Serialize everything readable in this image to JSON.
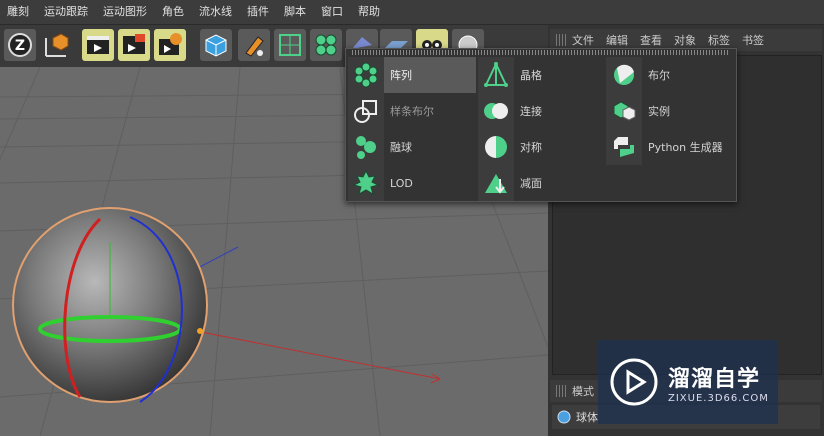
{
  "menubar": {
    "items": [
      "雕刻",
      "运动跟踪",
      "运动图形",
      "角色",
      "流水线",
      "插件",
      "脚本",
      "窗口",
      "帮助"
    ]
  },
  "toolbar": {
    "buttons": [
      {
        "icon": "z-snap-icon"
      },
      {
        "icon": "axis-cube-icon"
      },
      {
        "icon": "render-view-icon"
      },
      {
        "icon": "render-picture-icon"
      },
      {
        "icon": "render-settings-icon"
      },
      {
        "icon": "cube-icon"
      },
      {
        "icon": "pen-spline-icon"
      },
      {
        "icon": "subdivision-icon"
      },
      {
        "icon": "cloner-icon"
      },
      {
        "icon": "deformer-icon"
      },
      {
        "icon": "floor-icon"
      },
      {
        "icon": "camera-icon"
      },
      {
        "icon": "light-icon"
      }
    ]
  },
  "dropdown": {
    "columns": [
      [
        {
          "label": "阵列",
          "icon": "array-icon",
          "selected": true
        },
        {
          "label": "样条布尔",
          "icon": "spline-boole-icon",
          "dim": true
        },
        {
          "label": "融球",
          "icon": "metaball-icon"
        },
        {
          "label": "LOD",
          "icon": "lod-icon"
        }
      ],
      [
        {
          "label": "晶格",
          "icon": "atom-array-icon"
        },
        {
          "label": "连接",
          "icon": "connect-icon"
        },
        {
          "label": "对称",
          "icon": "symmetry-icon"
        },
        {
          "label": "减面",
          "icon": "polygon-reduction-icon"
        }
      ],
      [
        {
          "label": "布尔",
          "icon": "boole-icon"
        },
        {
          "label": "实例",
          "icon": "instance-icon"
        },
        {
          "label": "Python 生成器",
          "icon": "python-generator-icon"
        }
      ]
    ]
  },
  "right_panel": {
    "tabs": [
      "文件",
      "编辑",
      "查看",
      "对象",
      "标签",
      "书签"
    ],
    "attr_header": "模式",
    "object_row": "球体"
  },
  "watermark": {
    "title": "溜溜自学",
    "url": "ZIXUE.3D66.COM"
  },
  "colors": {
    "accent_yellow": "#d9d98a",
    "icon_green": "#4fd08a",
    "viewport_bg": "#6b6b6b"
  }
}
